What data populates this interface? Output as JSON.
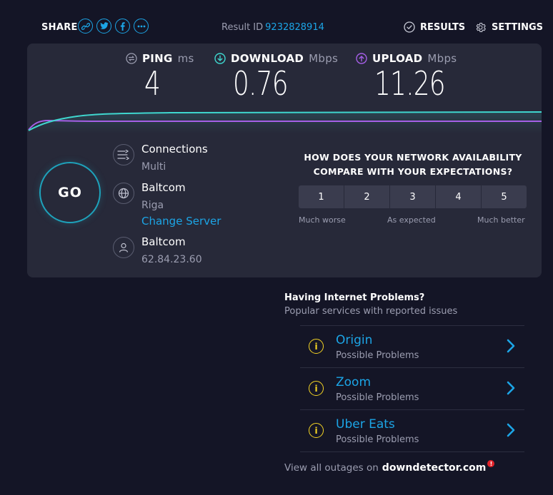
{
  "header": {
    "share_label": "SHARE",
    "share_icons": [
      "link-icon",
      "twitter-icon",
      "facebook-icon",
      "more-icon"
    ],
    "result_label": "Result ID",
    "result_id": "9232828914",
    "results_label": "RESULTS",
    "settings_label": "SETTINGS"
  },
  "metrics": {
    "ping": {
      "label": "PING",
      "unit": "ms",
      "value": "4"
    },
    "download": {
      "label": "DOWNLOAD",
      "unit": "Mbps",
      "value": "0.76"
    },
    "upload": {
      "label": "UPLOAD",
      "unit": "Mbps",
      "value": "11.26"
    }
  },
  "go_label": "GO",
  "connection": {
    "connections_title": "Connections",
    "connections_value": "Multi",
    "server_name": "Baltcom",
    "server_location": "Riga",
    "change_server_label": "Change Server",
    "isp_name": "Baltcom",
    "ip_address": "62.84.23.60"
  },
  "rating": {
    "question_line1": "HOW DOES YOUR NETWORK AVAILABILITY",
    "question_line2": "COMPARE WITH YOUR EXPECTATIONS?",
    "options": [
      "1",
      "2",
      "3",
      "4",
      "5"
    ],
    "label_low": "Much worse",
    "label_mid": "As expected",
    "label_high": "Much better"
  },
  "problems": {
    "title": "Having Internet Problems?",
    "subtitle": "Popular services with reported issues",
    "services": [
      {
        "name": "Origin",
        "status": "Possible Problems"
      },
      {
        "name": "Zoom",
        "status": "Possible Problems"
      },
      {
        "name": "Uber Eats",
        "status": "Possible Problems"
      }
    ],
    "footer_text": "View all outages on",
    "footer_brand": "downdetector.com"
  },
  "colors": {
    "background": "#141526",
    "panel": "#272939",
    "accent_blue": "#1ca5e6",
    "download_cyan": "#3fd7cf",
    "upload_purple": "#a55fe6",
    "warning_yellow": "#f5d524"
  }
}
